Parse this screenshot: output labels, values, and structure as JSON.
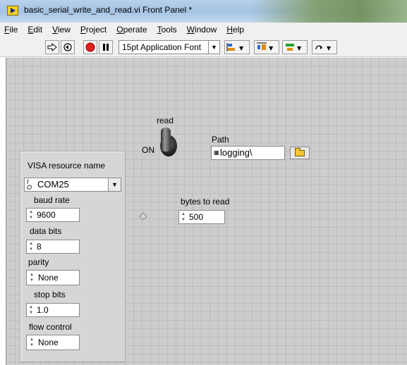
{
  "window": {
    "title": "basic_serial_write_and_read.vi Front Panel *"
  },
  "menu": {
    "items": [
      {
        "key": "F",
        "rest": "ile"
      },
      {
        "key": "E",
        "rest": "dit"
      },
      {
        "key": "V",
        "rest": "iew"
      },
      {
        "key": "P",
        "rest": "roject"
      },
      {
        "key": "O",
        "rest": "perate"
      },
      {
        "key": "T",
        "rest": "ools"
      },
      {
        "key": "W",
        "rest": "indow"
      },
      {
        "key": "H",
        "rest": "elp"
      }
    ]
  },
  "toolbar": {
    "run_icon": "run-arrow-icon",
    "run_continuous_icon": "run-continuously-icon",
    "abort_icon": "abort-icon",
    "pause_icon": "pause-icon",
    "font": "15pt Application Font",
    "dropdown_glyph": "▼"
  },
  "panel": {
    "toggle": {
      "label": "read",
      "state_text": "ON"
    },
    "path": {
      "label": "Path",
      "value": "logging\\"
    },
    "bytes_to_read": {
      "label": "bytes to read",
      "value": "500"
    },
    "cluster": {
      "visa_label": "VISA resource name",
      "visa_value": "COM25",
      "baud_rate": {
        "label": "baud rate",
        "value": "9600"
      },
      "data_bits": {
        "label": "data bits",
        "value": "8"
      },
      "parity": {
        "label": "parity",
        "value": "None"
      },
      "stop_bits": {
        "label": "stop bits",
        "value": "1.0"
      },
      "flow_control": {
        "label": "flow control",
        "value": "None"
      }
    }
  },
  "colors": {
    "canvas": "#cdcdcd",
    "grid": "#bdbdbd",
    "abort_red": "#e02020",
    "folder_yellow": "#f3c534"
  }
}
